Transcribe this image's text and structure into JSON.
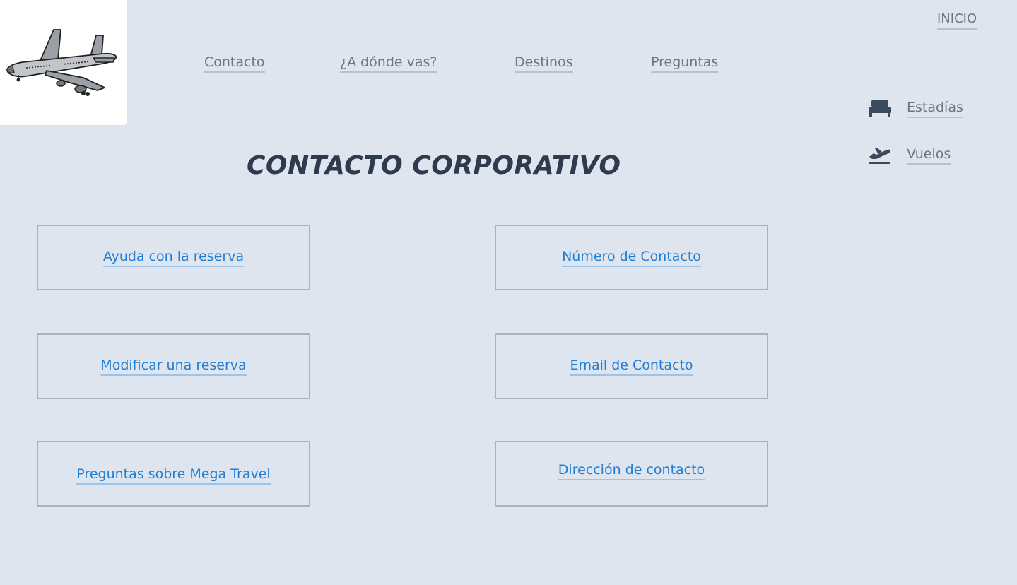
{
  "header": {
    "logo_icon": "airplane-icon",
    "home_label": "INICIO"
  },
  "nav": {
    "items": [
      {
        "label": "Contacto"
      },
      {
        "label": "¿A dónde vas?"
      },
      {
        "label": "Destinos"
      },
      {
        "label": "Preguntas"
      }
    ]
  },
  "sidebar": {
    "items": [
      {
        "label": "Estadías",
        "icon": "bed-icon"
      },
      {
        "label": "Vuelos",
        "icon": "flight-takeoff-icon"
      }
    ]
  },
  "main": {
    "title": "CONTACTO CORPORATIVO",
    "cards": [
      {
        "label": "Ayuda con la reserva"
      },
      {
        "label": "Número de Contacto"
      },
      {
        "label": "Modificar una reserva"
      },
      {
        "label": "Email de Contacto"
      },
      {
        "label": "Preguntas sobre Mega Travel"
      },
      {
        "label": "Dirección de contacto"
      }
    ]
  },
  "colors": {
    "background": "#dfe5ee",
    "title": "#2e3b4c",
    "link_blue": "#1f7ed6",
    "nav_text": "#6a7682",
    "card_border": "#a7b3c1"
  }
}
